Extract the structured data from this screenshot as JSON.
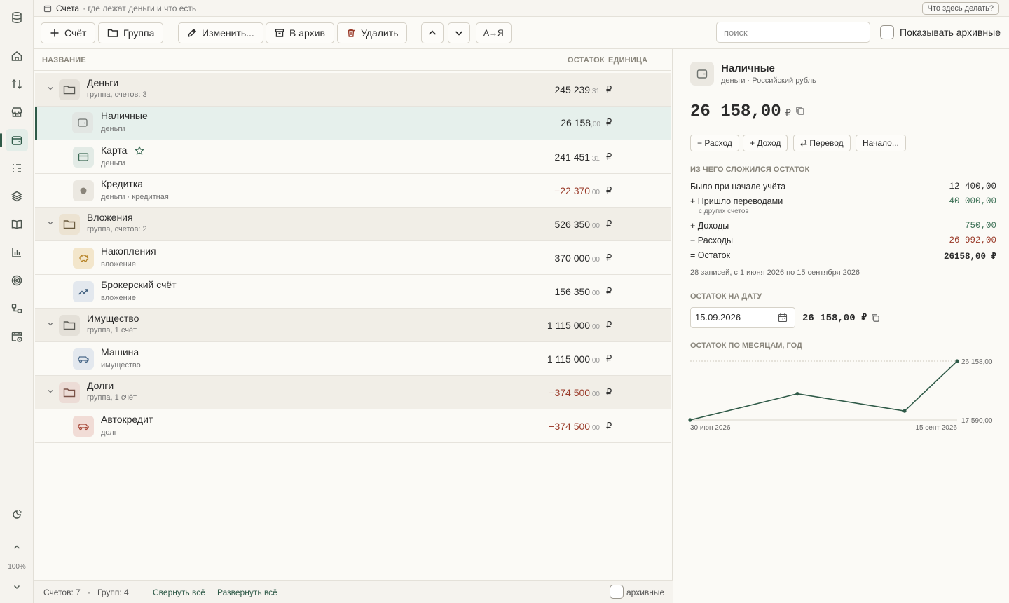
{
  "window": {
    "title": "Счета",
    "subtitle": "· где лежат деньги и что есть",
    "help": "Что здесь делать?"
  },
  "rail": {
    "zoom": "100%"
  },
  "toolbar": {
    "add_account": "Счёт",
    "add_group": "Группа",
    "edit": "Изменить...",
    "archive": "В архив",
    "delete": "Удалить",
    "sort": "А→Я",
    "search_placeholder": "поиск",
    "show_archived": "Показывать архивные"
  },
  "list": {
    "columns": {
      "name": "НАЗВАНИЕ",
      "balance": "ОСТАТОК",
      "unit": "ЕДИНИЦА"
    },
    "rows": [
      {
        "type": "group",
        "name": "Деньги",
        "sub": "группа, счетов: 3",
        "amount": "245 239",
        "cents": ",31",
        "unit": "₽"
      },
      {
        "type": "account",
        "name": "Наличные",
        "sub": "деньги",
        "amount": "26 158",
        "cents": ",00",
        "unit": "₽"
      },
      {
        "type": "account",
        "name": "Карта",
        "sub": "деньги",
        "amount": "241 451",
        "cents": ",31",
        "unit": "₽"
      },
      {
        "type": "account",
        "name": "Кредитка",
        "sub": "деньги · кредитная",
        "amount": "−22 370",
        "cents": ",00",
        "unit": "₽"
      },
      {
        "type": "group",
        "name": "Вложения",
        "sub": "группа, счетов: 2",
        "amount": "526 350",
        "cents": ",00",
        "unit": "₽"
      },
      {
        "type": "account",
        "name": "Накопления",
        "sub": "вложение",
        "amount": "370 000",
        "cents": ",00",
        "unit": "₽"
      },
      {
        "type": "account",
        "name": "Брокерский счёт",
        "sub": "вложение",
        "amount": "156 350",
        "cents": ",00",
        "unit": "₽"
      },
      {
        "type": "group",
        "name": "Имущество",
        "sub": "группа, 1 счёт",
        "amount": "1 115 000",
        "cents": ",00",
        "unit": "₽"
      },
      {
        "type": "account",
        "name": "Машина",
        "sub": "имущество",
        "amount": "1 115 000",
        "cents": ",00",
        "unit": "₽"
      },
      {
        "type": "group",
        "name": "Долги",
        "sub": "группа, 1 счёт",
        "amount": "−374 500",
        "cents": ",00",
        "unit": "₽"
      },
      {
        "type": "account",
        "name": "Автокредит",
        "sub": "долг",
        "amount": "−374 500",
        "cents": ",00",
        "unit": "₽"
      }
    ]
  },
  "footer": {
    "accounts": "Счетов: 7",
    "dot": "·",
    "groups": "Групп: 4",
    "collapse": "Свернуть всё",
    "expand": "Развернуть всё",
    "archived": "архивные"
  },
  "detail": {
    "title": "Наличные",
    "subtitle": "деньги · Российский рубль",
    "balance": "26 158,00",
    "currency": "₽",
    "actions": [
      "− Расход",
      "+ Доход",
      "⇄ Перевод",
      "Начало..."
    ],
    "breakdown_title": "ИЗ ЧЕГО СЛОЖИЛСЯ ОСТАТОК",
    "breakdown": [
      {
        "label": "Было при начале учёта",
        "value": "12 400,00"
      },
      {
        "label": "+ Пришло переводами",
        "value": "40 000,00",
        "note": "с других счетов"
      },
      {
        "label": "+ Доходы",
        "value": "750,00"
      },
      {
        "label": "− Расходы",
        "value": "26 992,00"
      },
      {
        "label": "= Остаток",
        "value": "26158,00 ₽"
      }
    ],
    "records": "28 записей, с 1 июня 2026 по 15 сентября 2026",
    "date_title": "ОСТАТОК НА ДАТУ",
    "date_value": "15.09.2026",
    "date_balance": "26 158,00 ₽",
    "chart_title": "ОСТАТОК ПО МЕСЯЦАМ, ГОД"
  },
  "chart_data": {
    "type": "line",
    "title": "ОСТАТОК ПО МЕСЯЦАМ, ГОД",
    "x": [
      "30 июн 2026",
      "31 июл 2026",
      "31 авг 2026",
      "15 сент 2026"
    ],
    "x_tick_labels": [
      "30 июн 2026",
      "15 сент 2026"
    ],
    "values": [
      17590,
      21400,
      18900,
      26158
    ],
    "y_labels": [
      "26 158,00",
      "17 590,00"
    ],
    "ylim": [
      17590,
      26158
    ],
    "grid": false,
    "color": "#2f5a48"
  }
}
